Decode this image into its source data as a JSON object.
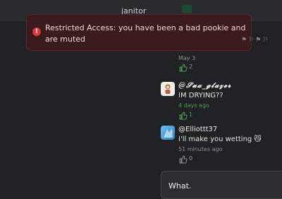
{
  "header": {
    "title": "janitor"
  },
  "alert": {
    "message": "Restricted Access: you have been a bad pookie and are muted",
    "icon": "alert-circle-icon",
    "color": "#e0353c"
  },
  "comments": [
    {
      "date": "May 3",
      "likes": "2",
      "liked": true
    },
    {
      "username": "@𝓢𝓾𝓪_𝓰𝓵𝓪𝔃𝓮𝓻",
      "text": "IM DRYING??",
      "date": "4 days ago",
      "likes": "1",
      "liked": true
    },
    {
      "username": "@Elliottt37",
      "text": "I'll make you wetting 😼",
      "date": "51 minutes ago",
      "likes": "0",
      "liked": false
    }
  ],
  "reply": {
    "value": "What."
  },
  "colors": {
    "like_active": "#4f9d57",
    "like_inactive": "#8d9096"
  }
}
